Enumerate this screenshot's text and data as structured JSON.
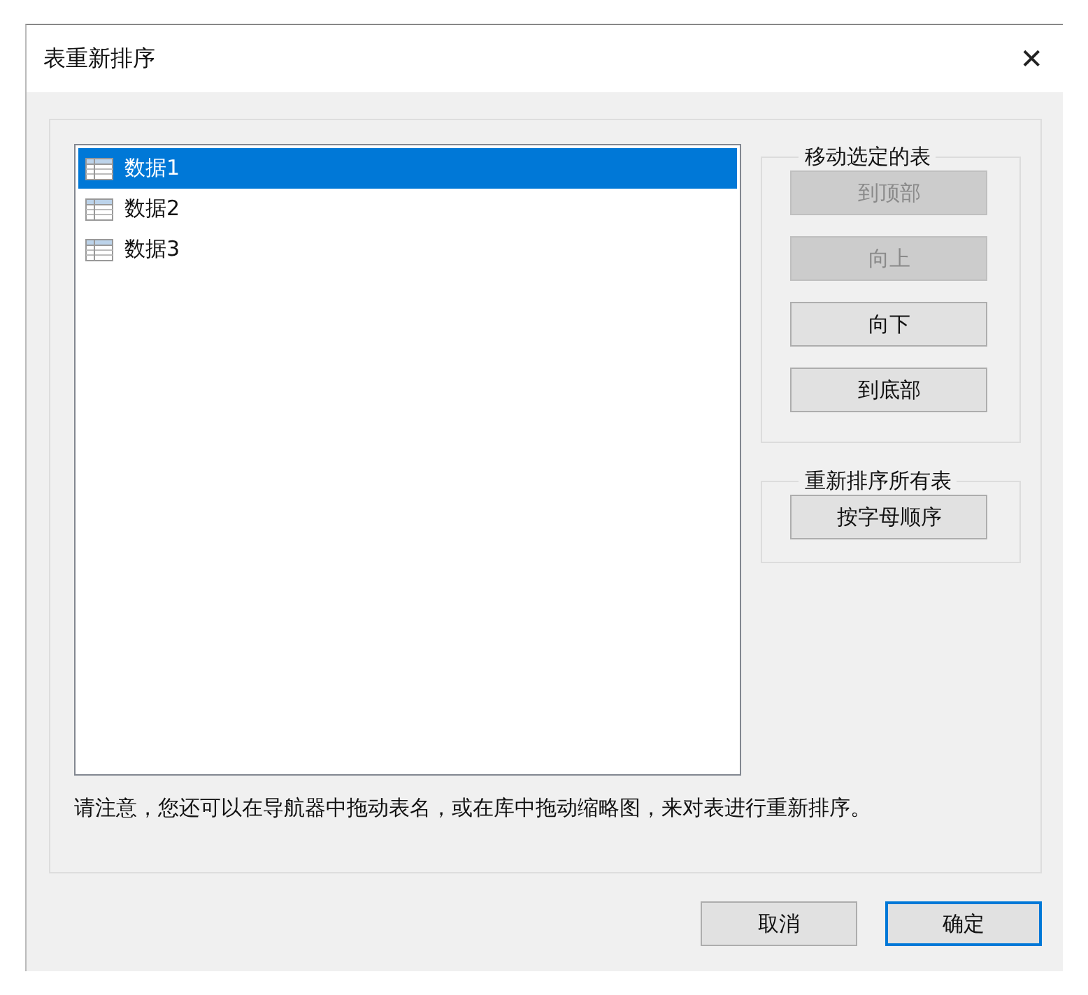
{
  "window": {
    "title": "表重新排序",
    "close": "✕"
  },
  "tables": [
    {
      "label": "数据1",
      "selected": true
    },
    {
      "label": "数据2",
      "selected": false
    },
    {
      "label": "数据3",
      "selected": false
    }
  ],
  "groups": [
    {
      "title": "移动选定的表",
      "buttons": [
        {
          "label": "到顶部",
          "disabled": true
        },
        {
          "label": "向上",
          "disabled": true
        },
        {
          "label": "向下",
          "disabled": false
        },
        {
          "label": "到底部",
          "disabled": false
        }
      ]
    },
    {
      "title": "重新排序所有表",
      "buttons": [
        {
          "label": "按字母顺序",
          "disabled": false
        }
      ]
    }
  ],
  "note": "请注意，您还可以在导航器中拖动表名，或在库中拖动缩略图，来对表进行重新排序。",
  "dialog_buttons": [
    {
      "label": "取消",
      "default": false
    },
    {
      "label": "确定",
      "default": true
    }
  ]
}
